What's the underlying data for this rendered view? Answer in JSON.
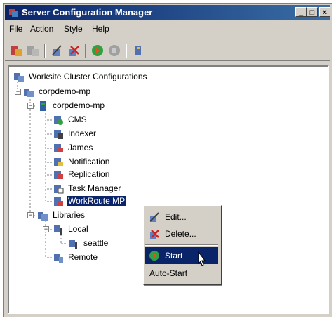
{
  "window": {
    "title": "Server Configuration Manager"
  },
  "titlebar_buttons": {
    "minimize": "_",
    "maximize": "□",
    "close": "×"
  },
  "menu": [
    "File",
    "Action",
    "Style",
    "Help"
  ],
  "toolbar": [
    "add-server-icon",
    "remove-server-icon",
    "edit-icon",
    "delete-icon",
    "start-icon",
    "stop-icon",
    "refresh-icon"
  ],
  "tree": {
    "root": "Worksite Cluster Configurations",
    "cluster": "corpdemo-mp",
    "server": "corpdemo-mp",
    "services": [
      "CMS",
      "Indexer",
      "James",
      "Notification",
      "Replication",
      "Task Manager",
      "WorkRoute MP"
    ],
    "selected_service": "WorkRoute MP",
    "libraries": "Libraries",
    "local": "Local",
    "local_child": "seattle",
    "remote": "Remote"
  },
  "context_menu": {
    "items": [
      "Edit...",
      "Delete...",
      "Start",
      "Auto-Start"
    ],
    "highlighted": "Start"
  },
  "colors": {
    "selection": "#0a246a",
    "window": "#d4d0c8",
    "title_start": "#0a246a",
    "title_end": "#3a6ea5"
  }
}
